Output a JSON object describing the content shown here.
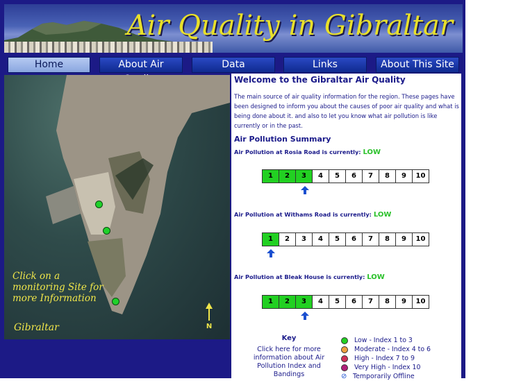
{
  "banner": {
    "title": "Air Quality in Gibraltar"
  },
  "nav": {
    "items": [
      {
        "label": "Home",
        "active": true
      },
      {
        "label": "About Air Quality",
        "active": false
      },
      {
        "label": "Data",
        "active": false
      },
      {
        "label": "Links",
        "active": false
      },
      {
        "label": "About This Site",
        "active": false
      }
    ]
  },
  "map": {
    "caption_lines": [
      "Click on a",
      "monitoring Site for",
      "more Information"
    ],
    "place_label": "Gibraltar",
    "north_label": "N"
  },
  "content": {
    "heading": "Welcome to the Gibraltar Air Quality",
    "intro": "The main source of air quality information for the region. These pages have been designed to inform you about the causes of poor air quality and what is being done about it. and also to let you know what air pollution is like currently or in the past.",
    "summary_heading": "Air Pollution Summary",
    "sites": [
      {
        "prefix": "Air Pollution at Rosia Road is currently:",
        "level": "LOW",
        "index": 3
      },
      {
        "prefix": "Air Pollution at Withams Road is currently:",
        "level": "LOW",
        "index": 1
      },
      {
        "prefix": "Air Pollution at Bleak House is currently:",
        "level": "LOW",
        "index": 3
      }
    ],
    "scale": [
      "1",
      "2",
      "3",
      "4",
      "5",
      "6",
      "7",
      "8",
      "9",
      "10"
    ]
  },
  "key": {
    "title": "Key",
    "link_text": "Click here for more information about Air Pollution Index and Bandings",
    "legend": [
      {
        "label": "Low - Index 1 to 3",
        "color": "#22d022"
      },
      {
        "label": "Moderate - Index 4 to 6",
        "color": "#f0a040"
      },
      {
        "label": "High - Index 7 to 9",
        "color": "#d0305a"
      },
      {
        "label": "Very High - Index 10",
        "color": "#b0207a"
      },
      {
        "label": "Temporarily Offline",
        "color": ""
      }
    ]
  },
  "colors": {
    "frame": "#1c1a86",
    "accent_text": "#1a1a8a",
    "title_yellow": "#e8e02a",
    "low_green": "#22d022"
  }
}
